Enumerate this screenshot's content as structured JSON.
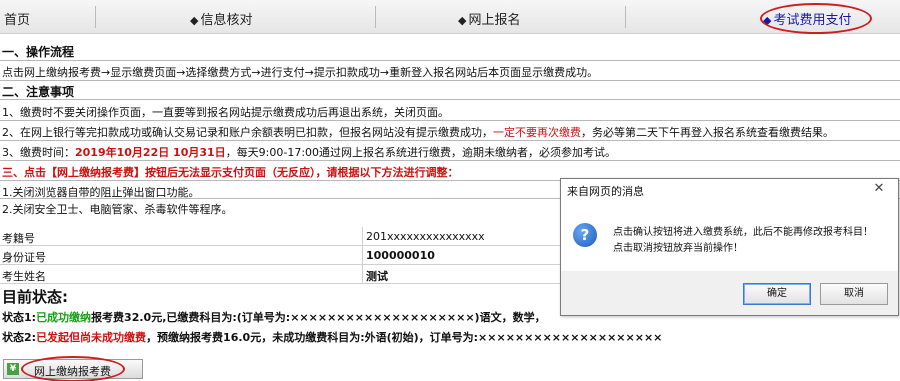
{
  "nav": {
    "home": "首页",
    "info_check": "信息核对",
    "online_reg": "网上报名",
    "fee_payment": "考试费用支付"
  },
  "sections": {
    "process_heading": "一、操作流程",
    "process_text": "点击网上缴纳报考费→显示缴费页面→选择缴费方式→进行支付→提示扣款成功→重新登入报名网站后本页面显示缴费成功。",
    "notes_heading": "二、注意事项",
    "note1": "1、缴费时不要关闭操作页面，一直要等到报名网站提示缴费成功后再退出系统，关闭页面。",
    "note2_a": "2、在网上银行等完扣款成功或确认交易记录和账户余额表明已扣款，但报名网站没有提示缴费成功，",
    "note2_red": "一定不要再次缴费",
    "note2_b": "，务必等第二天下午再登入报名系统查看缴费结果。",
    "note3_a": "3、缴费时间：",
    "note3_red": "2019年10月22日 10月31日",
    "note3_b": "，每天9:00-17:00通过网上报名系统进行缴费，逾期未缴纳者，必须参加考试。",
    "third_heading": "三、点击【网上缴纳报考费】按钮后无法显示支付页面（无反应），请根据以下方法进行调整：",
    "fix1": "1.关闭浏览器自带的阻止弹出窗口功能。",
    "fix2": "2.关闭安全卫士、电脑管家、杀毒软件等程序。"
  },
  "info": {
    "exam_no_label": "考籍号",
    "exam_no_value": "201xxxxxxxxxxxxxxx",
    "id_label": "身份证号",
    "id_value": "100000010",
    "name_label": "考生姓名",
    "name_value": "测试"
  },
  "status": {
    "title": "目前状态:",
    "s1_prefix": "状态1:",
    "s1_green": "已成功缴纳",
    "s1_text": "报考费32.0元,已缴费科目为:(订单号为:××××××××××××××××××××)语文，数学，",
    "s2_prefix": "状态2:",
    "s2_red": "已发起但尚未成功缴费",
    "s2_text": "，预缴纳报考费16.0元，未成功缴费科目为:外语(初始)，订单号为:××××××××××××××××××××"
  },
  "pay_button": {
    "label": "网上缴纳报考费"
  },
  "dialog": {
    "title": "来自网页的消息",
    "close": "✕",
    "line1": "点击确认按钮将进入缴费系统，此后不能再修改报考科目！",
    "line2": "点击取消按钮放弃当前操作！",
    "ok": "确定",
    "cancel": "取消"
  }
}
